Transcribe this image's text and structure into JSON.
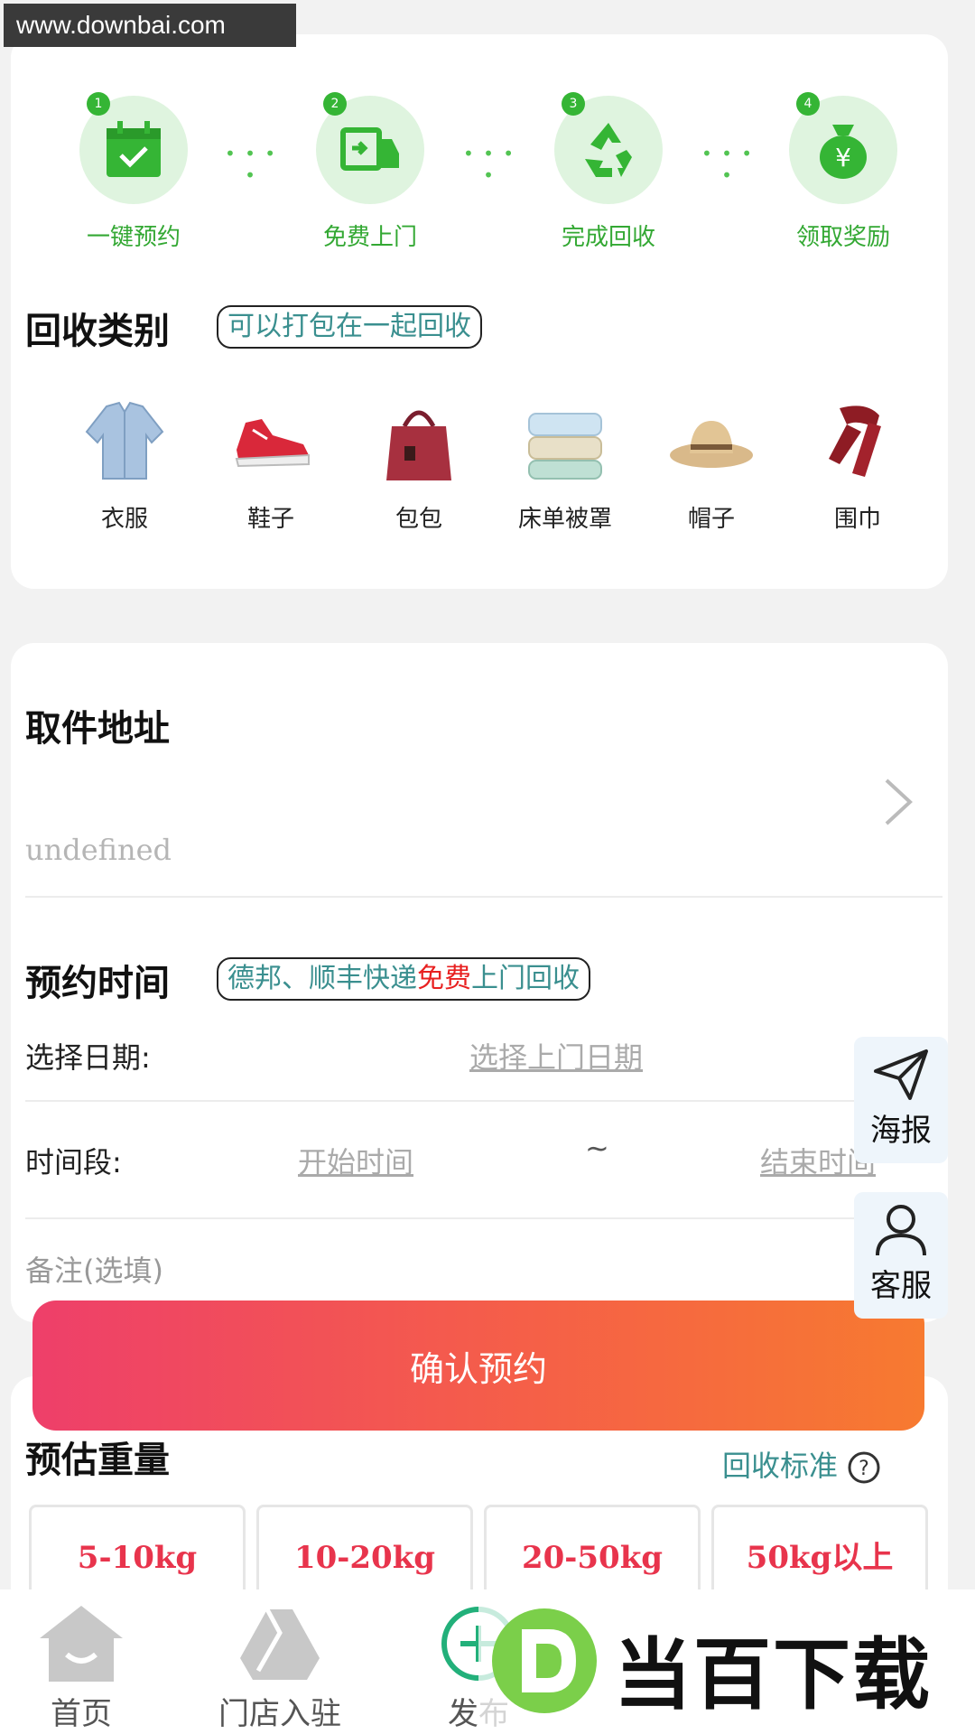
{
  "watermark": "www.downbai.com",
  "steps": [
    {
      "num": "1",
      "label": "一键预约",
      "icon": "calendar-check-icon"
    },
    {
      "num": "2",
      "label": "免费上门",
      "icon": "truck-icon"
    },
    {
      "num": "3",
      "label": "完成回收",
      "icon": "recycle-icon"
    },
    {
      "num": "4",
      "label": "领取奖励",
      "icon": "money-bag-icon"
    }
  ],
  "category_section": {
    "title": "回收类别",
    "tag": "可以打包在一起回收",
    "items": [
      {
        "label": "衣服",
        "icon": "jacket-icon"
      },
      {
        "label": "鞋子",
        "icon": "sneaker-icon"
      },
      {
        "label": "包包",
        "icon": "handbag-icon"
      },
      {
        "label": "床单被罩",
        "icon": "bedding-icon"
      },
      {
        "label": "帽子",
        "icon": "hat-icon"
      },
      {
        "label": "围巾",
        "icon": "scarf-icon"
      }
    ]
  },
  "address_section": {
    "title": "取件地址",
    "value": "undefined"
  },
  "time_section": {
    "title": "预约时间",
    "tag_part1": "德邦、顺丰快递",
    "tag_red": "免费",
    "tag_part2": "上门回收",
    "date_label": "选择日期:",
    "date_placeholder": "选择上门日期",
    "period_label": "时间段:",
    "start_placeholder": "开始时间",
    "separator": "~",
    "end_placeholder": "结束时间",
    "note_placeholder": "备注(选填)"
  },
  "confirm_button": "确认预约",
  "side_buttons": {
    "poster": "海报",
    "service": "客服"
  },
  "weight_section": {
    "title": "预估重量",
    "standard_link": "回收标准",
    "options": [
      "5-10kg",
      "10-20kg",
      "20-50kg",
      "50kg以上"
    ]
  },
  "tabbar": [
    {
      "label": "首页",
      "icon": "home-icon"
    },
    {
      "label": "门店入驻",
      "icon": "store-icon"
    },
    {
      "label": "发布",
      "icon": "plus-circle-icon"
    }
  ],
  "brand_overlay": "当百下载",
  "colors": {
    "green": "#35b535",
    "accent_red": "#e8344c",
    "button_gradient_start": "#ee3f6a",
    "button_gradient_end": "#f77a30"
  }
}
